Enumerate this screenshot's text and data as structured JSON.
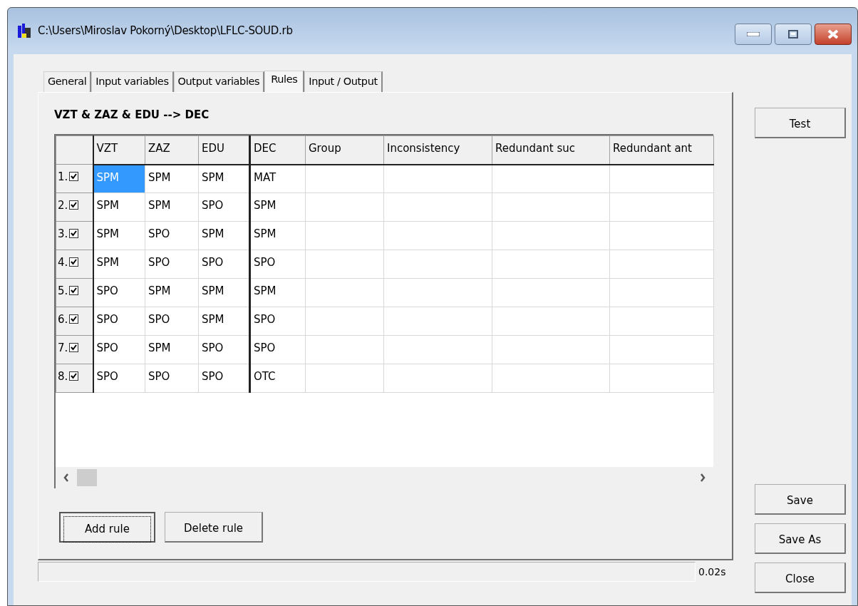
{
  "window": {
    "title": "C:\\Users\\Miroslav Pokorný\\Desktop\\LFLC-SOUD.rb"
  },
  "tabs": [
    {
      "label": "General",
      "selected": false
    },
    {
      "label": "Input variables",
      "selected": false
    },
    {
      "label": "Output variables",
      "selected": false
    },
    {
      "label": "Rules",
      "selected": true
    },
    {
      "label": "Input / Output",
      "selected": false
    }
  ],
  "rule_base_header": "VZT & ZAZ & EDU --> DEC",
  "table": {
    "columns": [
      "VZT",
      "ZAZ",
      "EDU",
      "DEC",
      "Group",
      "Inconsistency",
      "Redundant suc",
      "Redundant ant"
    ],
    "rows": [
      {
        "number": "1.",
        "checked": true,
        "cells": [
          {
            "text": "SPM",
            "selected": true
          },
          {
            "text": "SPM",
            "selected": false
          },
          {
            "text": "SPM",
            "selected": false
          },
          {
            "text": "MAT",
            "selected": false
          }
        ]
      },
      {
        "number": "2.",
        "checked": true,
        "cells": [
          {
            "text": "SPM",
            "selected": false
          },
          {
            "text": "SPM",
            "selected": false
          },
          {
            "text": "SPO",
            "selected": false
          },
          {
            "text": "SPM",
            "selected": false
          }
        ]
      },
      {
        "number": "3.",
        "checked": true,
        "cells": [
          {
            "text": "SPM",
            "selected": false
          },
          {
            "text": "SPO",
            "selected": false
          },
          {
            "text": "SPM",
            "selected": false
          },
          {
            "text": "SPM",
            "selected": false
          }
        ]
      },
      {
        "number": "4.",
        "checked": true,
        "cells": [
          {
            "text": "SPM",
            "selected": false
          },
          {
            "text": "SPO",
            "selected": false
          },
          {
            "text": "SPO",
            "selected": false
          },
          {
            "text": "SPO",
            "selected": false
          }
        ]
      },
      {
        "number": "5.",
        "checked": true,
        "cells": [
          {
            "text": "SPO",
            "selected": false
          },
          {
            "text": "SPM",
            "selected": false
          },
          {
            "text": "SPM",
            "selected": false
          },
          {
            "text": "SPM",
            "selected": false
          }
        ]
      },
      {
        "number": "6.",
        "checked": true,
        "cells": [
          {
            "text": "SPO",
            "selected": false
          },
          {
            "text": "SPO",
            "selected": false
          },
          {
            "text": "SPM",
            "selected": false
          },
          {
            "text": "SPO",
            "selected": false
          }
        ]
      },
      {
        "number": "7.",
        "checked": true,
        "cells": [
          {
            "text": "SPO",
            "selected": false
          },
          {
            "text": "SPM",
            "selected": false
          },
          {
            "text": "SPO",
            "selected": false
          },
          {
            "text": "SPO",
            "selected": false
          }
        ]
      },
      {
        "number": "8.",
        "checked": true,
        "cells": [
          {
            "text": "SPO",
            "selected": false
          },
          {
            "text": "SPO",
            "selected": false
          },
          {
            "text": "SPO",
            "selected": false
          },
          {
            "text": "OTC",
            "selected": false
          }
        ]
      }
    ]
  },
  "panel_buttons": [
    {
      "label": "Add rule",
      "focused": true
    },
    {
      "label": "Delete rule",
      "focused": false
    }
  ],
  "status_bar": {
    "time": "0.02s"
  },
  "side_buttons": [
    {
      "label": "Test"
    },
    {
      "label": "Save"
    },
    {
      "label": "Save As"
    },
    {
      "label": "Close"
    }
  ]
}
